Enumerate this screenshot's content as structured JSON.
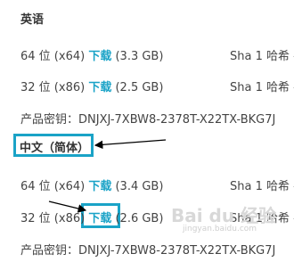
{
  "sections": [
    {
      "heading": "英语",
      "rows": [
        {
          "arch": "64 位 (x64)",
          "link": "下载",
          "size": "(3.3 GB)",
          "hash": "Sha 1 哈希 -"
        },
        {
          "arch": "32 位 (x86)",
          "link": "下载",
          "size": "(2.5 GB)",
          "hash": "Sha 1 哈希 -"
        }
      ],
      "key": "产品密钥：DNJXJ-7XBW8-2378T-X22TX-BKG7J"
    },
    {
      "heading": "中文（简体）",
      "rows": [
        {
          "arch": "64 位 (x64)",
          "link": "下载",
          "size": "(3.4 GB)",
          "hash": "Sha 1 哈希 -"
        },
        {
          "arch": "32 位 (x86)",
          "link": "下载",
          "size": "(2.6 GB)",
          "hash": "Sha 1 哈希 -"
        }
      ],
      "key": "产品密钥：DNJXJ-7XBW8-2378T-X22TX-BKG7J"
    }
  ],
  "watermark": {
    "brand": "Bai du 经验",
    "url": "jingyan.baidu.com"
  },
  "colors": {
    "link": "#1aa3c7",
    "highlight_box": "#1aa3c7",
    "arrow": "#000000"
  }
}
